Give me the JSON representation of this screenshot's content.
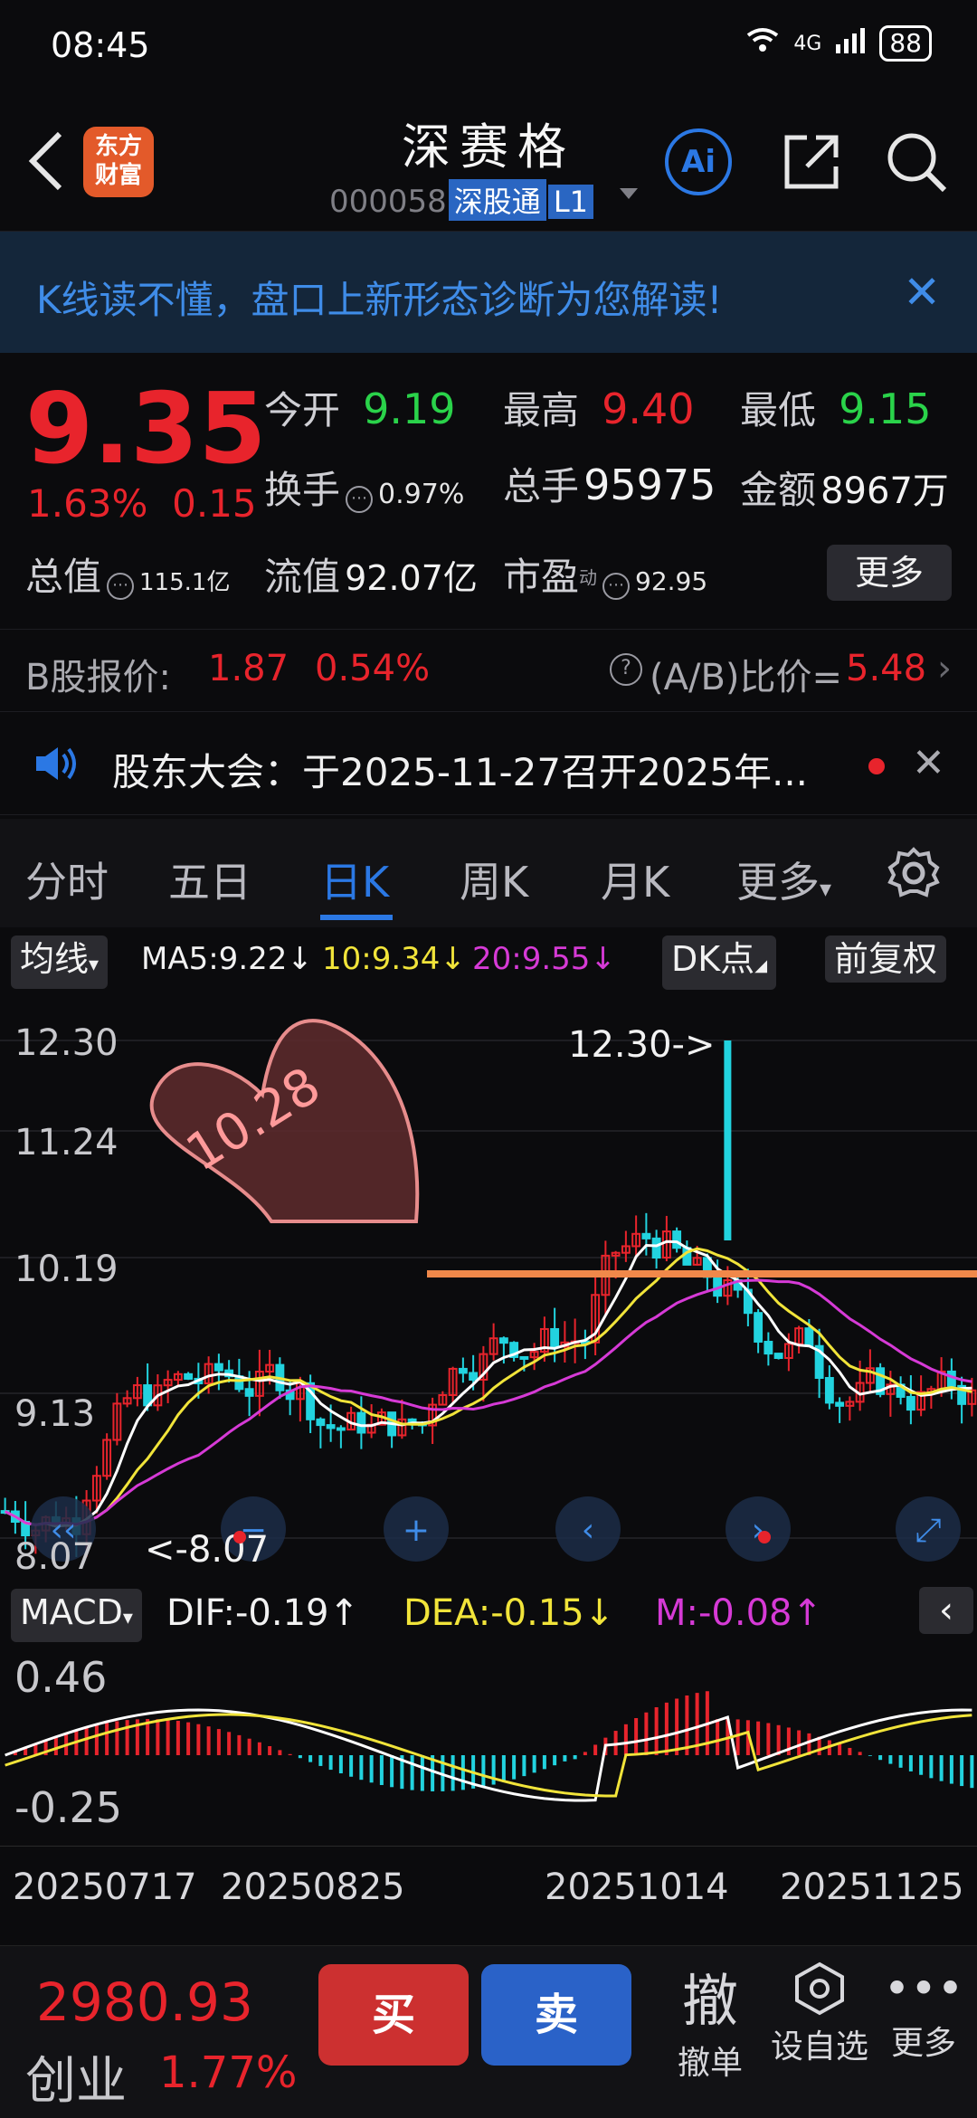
{
  "status": {
    "time": "08:45",
    "network": "4G",
    "battery": "88"
  },
  "header": {
    "title": "深赛格",
    "code": "000058",
    "tag1": "深股通",
    "tag2": "L1",
    "logo_line1": "东方",
    "logo_line2": "财富",
    "ai_label": "Ai"
  },
  "banner": {
    "text": "K线读不懂，盘口上新形态诊断为您解读!"
  },
  "quote": {
    "price": "9.35",
    "change_pct": "1.63%",
    "change": "0.15",
    "open_label": "今开",
    "open": "9.19",
    "high_label": "最高",
    "high": "9.40",
    "low_label": "最低",
    "low": "9.15",
    "turnover_label": "换手",
    "turnover": "0.97%",
    "volume_label": "总手",
    "volume": "95975",
    "amount_label": "金额",
    "amount": "8967万",
    "mcap_label": "总值",
    "mcap": "115.1亿",
    "float_label": "流值",
    "float": "92.07亿",
    "pe_label": "市盈",
    "pe_sup": "动",
    "pe": "92.95",
    "more": "更多"
  },
  "bshare": {
    "label": "B股报价:",
    "price": "1.87",
    "pct": "0.54%",
    "ratio_label": "(A/B)比价=",
    "ratio": "5.48"
  },
  "notice": {
    "text": "股东大会：于2025-11-27召开2025年..."
  },
  "tabs": [
    "分时",
    "五日",
    "日K",
    "周K",
    "月K",
    "更多"
  ],
  "ma": {
    "selector": "均线",
    "ma5": "MA5:9.22",
    "ma10": "10:9.34",
    "ma20": "20:9.55",
    "dk": "DK点",
    "adj": "前复权"
  },
  "chart": {
    "y_labels": [
      "12.30",
      "11.24",
      "10.19",
      "9.13",
      "8.07"
    ],
    "high_note": "12.30->",
    "low_note": "<-8.07",
    "sticker": "10.28",
    "colors": {
      "up": "#e8242c",
      "down": "#22d3df",
      "ma5": "#ffffff",
      "ma10": "#f1e43a",
      "ma20": "#d63ad6",
      "line": "#f0884a"
    }
  },
  "macd": {
    "selector": "MACD",
    "dif": "DIF:-0.19",
    "dea": "DEA:-0.15",
    "m": "M:-0.08",
    "y_top": "0.46",
    "y_bottom": "-0.25"
  },
  "dates": [
    "20250717",
    "20250825",
    "20251014",
    "20251125"
  ],
  "bottom": {
    "index_value": "2980.93",
    "index_name": "创业",
    "index_pct": "1.77%",
    "buy": "买",
    "sell": "卖",
    "cancel_icon": "撤",
    "cancel": "撤单",
    "watch": "设自选",
    "more": "更多"
  }
}
